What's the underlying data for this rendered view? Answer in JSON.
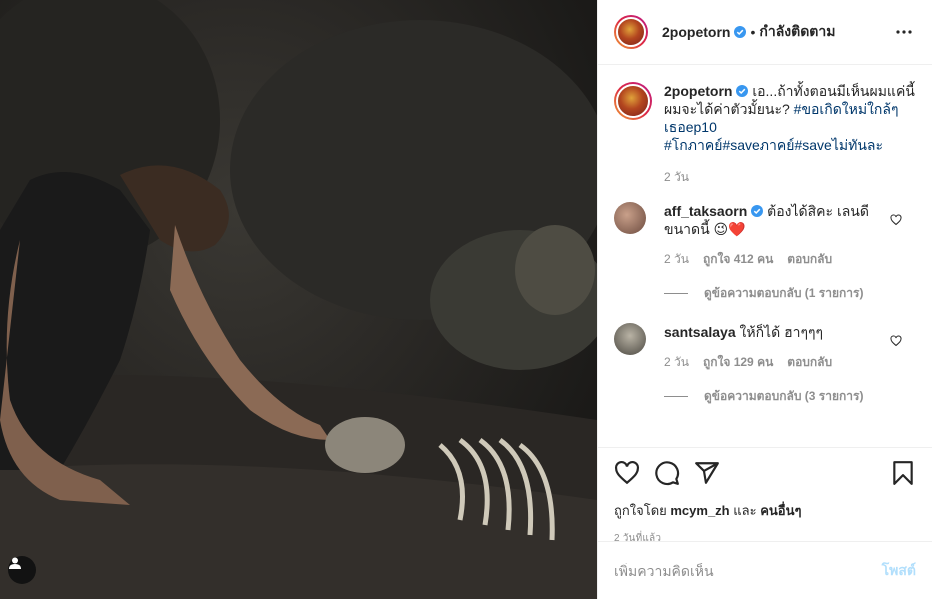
{
  "header": {
    "username": "2popetorn",
    "separator": "•",
    "follow_status": "กำลังติดตาม"
  },
  "caption": {
    "username": "2popetorn",
    "text": "เอ...ถ้าทั้งตอนมีเห็นผมแค่นี้ ผมจะได้ค่าตัวมั้ยนะ?",
    "hashtags_line1": "#ขอเกิดใหม่ใกล้ๆเธอep10",
    "hashtags_line2": "#โกภาคย์#saveภาคย์#saveไม่ทันละ",
    "time": "2 วัน"
  },
  "comments": [
    {
      "username": "aff_taksaorn",
      "text": "ต้องได้สิคะ เลนดีขนาดนี้ 😉❤️",
      "time": "2 วัน",
      "likes": "ถูกใจ 412 คน",
      "reply": "ตอบกลับ",
      "view_replies": "ดูข้อความตอบกลับ (1 รายการ)"
    },
    {
      "username": "santsalaya",
      "text": "ให้ก็ได้ ฮาๆๆๆ",
      "time": "2 วัน",
      "likes": "ถูกใจ 129 คน",
      "reply": "ตอบกลับ",
      "view_replies": "ดูข้อความตอบกลับ (3 รายการ)"
    }
  ],
  "likes_line": {
    "prefix": "ถูกใจโดย",
    "user": "mcym_zh",
    "and": "และ",
    "others": "คนอื่นๆ"
  },
  "post_time": "2 วันที่แล้ว",
  "comment_box": {
    "placeholder": "เพิ่มความคิดเห็น",
    "post_label": "โพสต์"
  },
  "icons": {
    "verified": "verified-badge-icon",
    "more": "more-options-icon",
    "heart": "heart-icon",
    "comment": "comment-icon",
    "share": "share-icon",
    "save": "bookmark-icon",
    "user_tag": "user-tag-icon"
  },
  "colors": {
    "verified": "#3897f0",
    "link": "#00376b",
    "muted": "#8e8e8e",
    "post_disabled": "#b2dffc"
  }
}
